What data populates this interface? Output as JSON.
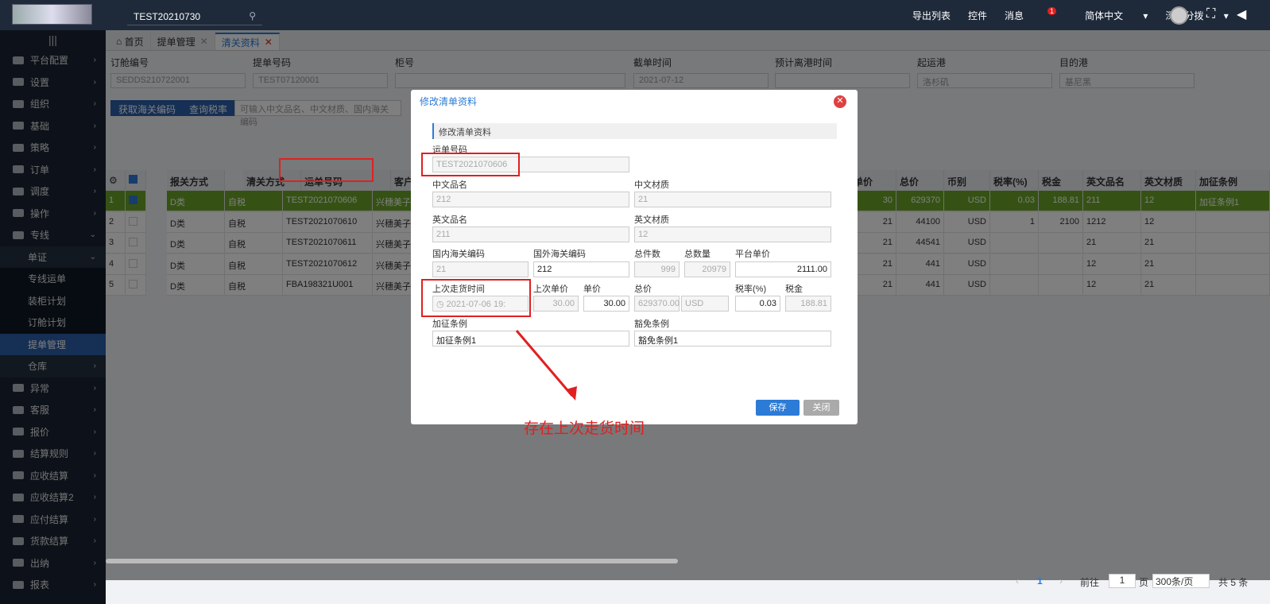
{
  "topbar": {
    "search": "TEST20210730",
    "export": "导出列表",
    "control": "控件",
    "messages": "消息",
    "msg_count": "1",
    "language": "简体中文",
    "branch": "深圳分拨"
  },
  "sidebar": {
    "items": [
      "平台配置",
      "设置",
      "组织",
      "基础",
      "策略",
      "订单",
      "调度",
      "操作",
      "专线"
    ],
    "sub_group": "单证",
    "sub_items": [
      "专线运单",
      "装柜计划",
      "订舱计划",
      "提单管理"
    ],
    "after": [
      "仓库",
      "异常",
      "客服",
      "报价",
      "结算规则",
      "应收结算",
      "应收结算2",
      "应付结算",
      "货款结算",
      "出纳",
      "报表"
    ]
  },
  "tabs": [
    "首页",
    "提单管理",
    "清关资料"
  ],
  "filters": {
    "labels": [
      "订舱编号",
      "提单号码",
      "柜号",
      "截单时间",
      "预计离港时间",
      "起运港",
      "目的港"
    ],
    "values": [
      "SEDDS210722001",
      "TEST07120001",
      "",
      "2021-07-12",
      "",
      "洛杉矶",
      "基尼黑"
    ],
    "btn1": "获取海关编码",
    "btn2": "查询税率",
    "search_placeholder": "可输入中文品名、中文材质、国内海关编码"
  },
  "grid": {
    "headers_left": [
      "报关方式",
      "清关方式",
      "运单号码",
      "客户"
    ],
    "headers_right": [
      "单价",
      "总价",
      "币别",
      "税率(%)",
      "税金",
      "英文品名",
      "英文材质",
      "加征条例"
    ],
    "rows": [
      {
        "n": "1",
        "a": "D类",
        "b": "自税",
        "c": "TEST2021070606",
        "d": "兴穗美子",
        "e": "30",
        "u": "30",
        "t": "629370",
        "cur": "USD",
        "rate": "0.03",
        "tax": "188.81",
        "en": "211",
        "mat": "12",
        "add": "加征条例1",
        "sel": true
      },
      {
        "n": "2",
        "a": "D类",
        "b": "自税",
        "c": "TEST2021070610",
        "d": "兴穗美子",
        "e": "21",
        "u": "21",
        "t": "44100",
        "cur": "USD",
        "rate": "1",
        "tax": "2100",
        "en": "1212",
        "mat": "12",
        "add": ""
      },
      {
        "n": "3",
        "a": "D类",
        "b": "自税",
        "c": "TEST2021070611",
        "d": "兴穗美子",
        "e": "21",
        "u": "21",
        "t": "44541",
        "cur": "USD",
        "rate": "",
        "tax": "",
        "en": "21",
        "mat": "21",
        "add": ""
      },
      {
        "n": "4",
        "a": "D类",
        "b": "自税",
        "c": "TEST2021070612",
        "d": "兴穗美子",
        "e": "",
        "u": "21",
        "t": "441",
        "cur": "USD",
        "rate": "",
        "tax": "",
        "en": "12",
        "mat": "21",
        "add": ""
      },
      {
        "n": "5",
        "a": "D类",
        "b": "自税",
        "c": "FBA198321U001",
        "d": "兴穗美子",
        "e": "21",
        "u": "21",
        "t": "441",
        "cur": "USD",
        "rate": "",
        "tax": "",
        "en": "12",
        "mat": "21",
        "add": ""
      }
    ]
  },
  "pager": {
    "page": "1",
    "goto_label": "前往",
    "goto": "1",
    "page_unit": "页",
    "per_page": "300条/页",
    "total": "共 5 条"
  },
  "modal": {
    "title": "修改清单资料",
    "section": "修改清单资料",
    "tracking_label": "运单号码",
    "tracking": "TEST2021070606",
    "cn_name_label": "中文品名",
    "cn_name": "212",
    "cn_mat_label": "中文材质",
    "cn_mat": "21",
    "en_name_label": "英文品名",
    "en_name": "211",
    "en_mat_label": "英文材质",
    "en_mat": "12",
    "dom_code_label": "国内海关编码",
    "dom_code": "21",
    "for_code_label": "国外海关编码",
    "for_code": "212",
    "pieces_label": "总件数",
    "pieces": "999",
    "qty_label": "总数量",
    "qty": "20979",
    "plat_price_label": "平台单价",
    "plat_price": "2111.00",
    "last_time_label": "上次走货时间",
    "last_time": "2021-07-06 19:",
    "last_price_label": "上次单价",
    "last_price": "30.00",
    "price_label": "单价",
    "price": "30.00",
    "total_label": "总价",
    "total": "629370.00",
    "currency": "USD",
    "rate_label": "税率(%)",
    "rate": "0.03",
    "tax_label": "税金",
    "tax": "188.81",
    "add_label": "加征条例",
    "add": "加征条例1",
    "exempt_label": "豁免条例",
    "exempt": "豁免条例1",
    "save": "保存",
    "close": "关闭"
  },
  "annotation": "存在上次走货时间"
}
